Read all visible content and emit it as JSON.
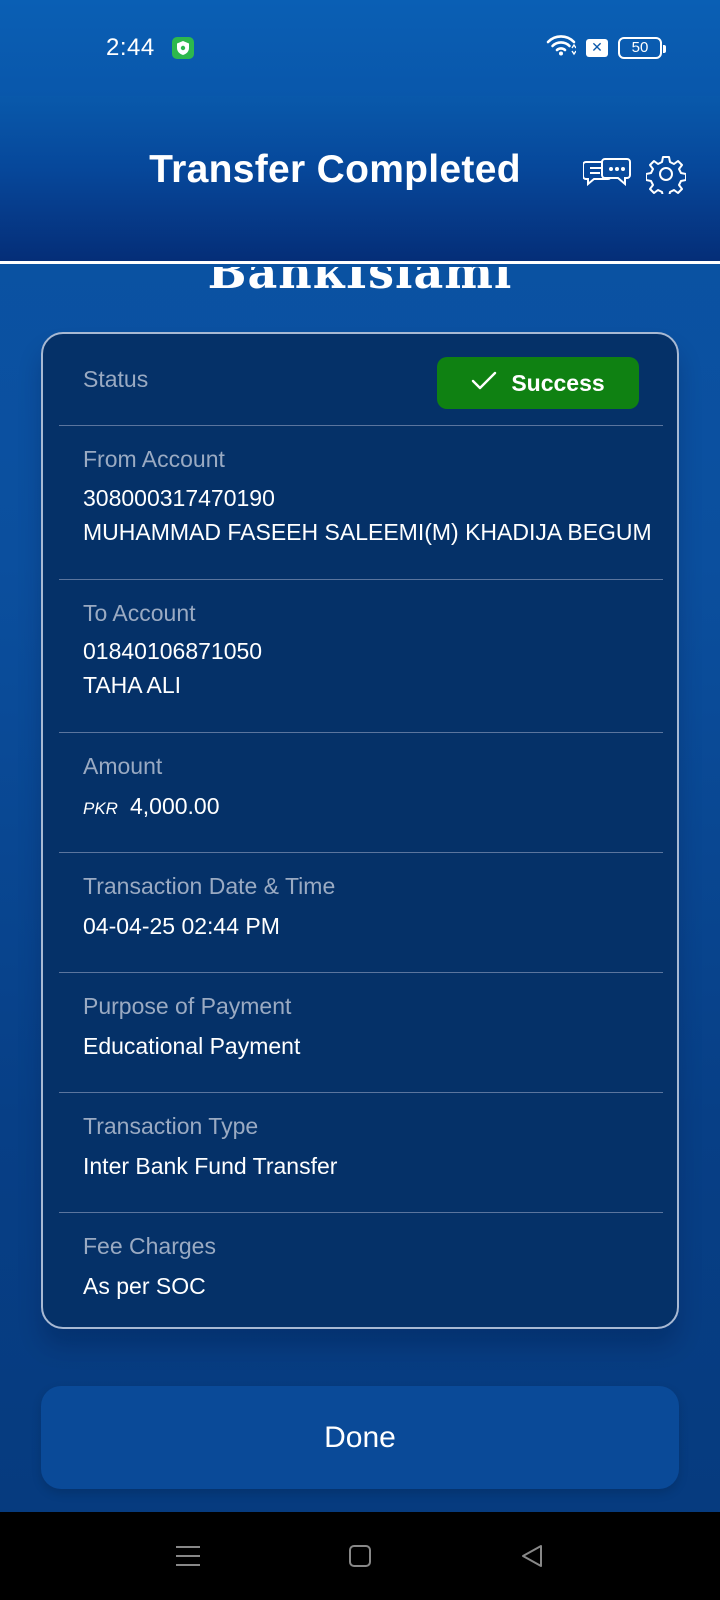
{
  "status_bar": {
    "time": "2:44",
    "battery": "50",
    "icons": [
      "shield-icon",
      "wifi-icon",
      "x-badge-icon",
      "battery-icon"
    ]
  },
  "header": {
    "title": "Transfer Completed",
    "brand_peek": "BankIslami",
    "icons": [
      "chat-icon",
      "gear-icon"
    ]
  },
  "receipt": {
    "status": {
      "label": "Status",
      "badge": "Success",
      "badge_color": "#0f8112"
    },
    "from_account": {
      "label": "From Account",
      "number": "308000317470190",
      "name": "MUHAMMAD FASEEH SALEEMI(M) KHADIJA BEGUM"
    },
    "to_account": {
      "label": "To Account",
      "number": "01840106871050",
      "name": "TAHA ALI"
    },
    "amount": {
      "label": "Amount",
      "currency": "PKR",
      "value": "4,000.00"
    },
    "datetime": {
      "label": "Transaction Date & Time",
      "value": "04-04-25 02:44 PM"
    },
    "purpose": {
      "label": "Purpose of Payment",
      "value": "Educational Payment"
    },
    "type": {
      "label": "Transaction Type",
      "value": "Inter Bank Fund Transfer"
    },
    "fee": {
      "label": "Fee Charges",
      "value": "As per SOC"
    }
  },
  "actions": {
    "done_label": "Done"
  },
  "nav": {
    "icons": [
      "menu-icon",
      "home-icon",
      "back-icon"
    ]
  }
}
